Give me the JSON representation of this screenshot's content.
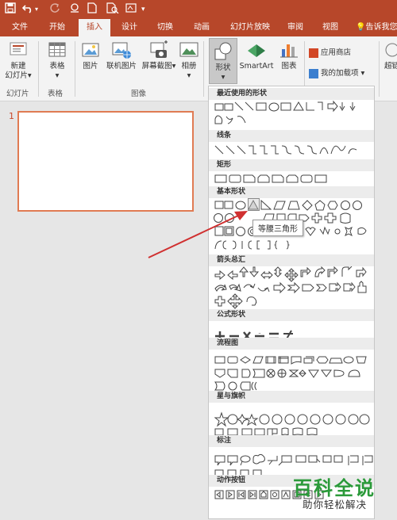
{
  "quick_access": {
    "save_icon": "save-icon",
    "undo_icon": "undo-icon",
    "redo_icon": "redo-icon",
    "repeat_icon": "repeat-icon",
    "new_icon": "new-document-icon",
    "preview_icon": "print-preview-icon",
    "format_icon": "format-icon",
    "dropdown_icon": "customize-icon"
  },
  "tabs": [
    {
      "label": "文件",
      "active": false
    },
    {
      "label": "开始",
      "active": false
    },
    {
      "label": "插入",
      "active": true
    },
    {
      "label": "设计",
      "active": false
    },
    {
      "label": "切换",
      "active": false
    },
    {
      "label": "动画",
      "active": false
    },
    {
      "label": "幻灯片放映",
      "active": false
    },
    {
      "label": "审阅",
      "active": false
    },
    {
      "label": "视图",
      "active": false
    }
  ],
  "tell_me": "告诉我您",
  "ribbon": {
    "new_slide_1": "新建",
    "new_slide_2": "幻灯片",
    "table": "表格",
    "picture": "图片",
    "online_picture": "联机图片",
    "screenshot": "屏幕截图",
    "album": "相册",
    "shapes": "形状",
    "smartart": "SmartArt",
    "chart": "图表",
    "store": "应用商店",
    "my_addins": "我的加载项",
    "hyperlink_partial": "超链",
    "groups": {
      "slides": "幻灯片",
      "tables": "表格",
      "images": "图像"
    }
  },
  "slide_panel": {
    "slide_number": "1"
  },
  "gallery": {
    "sections": [
      "最近使用的形状",
      "线条",
      "矩形",
      "基本形状",
      "箭头总汇",
      "公式形状",
      "流程图",
      "星与旗帜",
      "标注",
      "动作按钮"
    ],
    "tooltip": "等腰三角形"
  },
  "watermark": {
    "big": "百科全说",
    "small": "助你轻松解决"
  },
  "colors": {
    "accent": "#b7472a",
    "arrow": "#d03030",
    "watermark_green": "#2b9a3a"
  }
}
